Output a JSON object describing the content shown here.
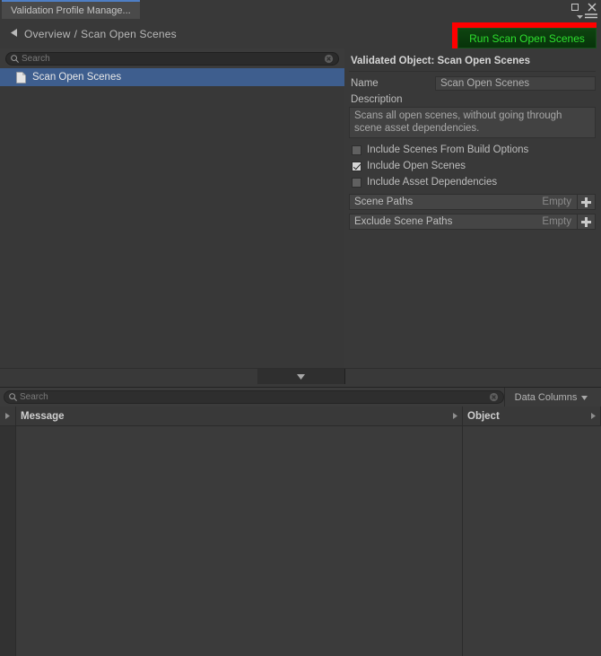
{
  "window": {
    "tab_label": "Validation Profile Manage...",
    "maximize_icon": "maximize-icon",
    "close_icon": "close-icon",
    "menu_icon": "hamburger-menu-icon"
  },
  "breadcrumb": {
    "back_arrow": "◀",
    "root": "Overview",
    "separator": "/",
    "current": "Scan Open Scenes"
  },
  "run_button": {
    "label": "Run Scan Open Scenes",
    "text_color": "#2ee02e",
    "fill_color": "#0b3c0e",
    "highlight_color": "#ff0000"
  },
  "left_panel": {
    "search": {
      "placeholder": "Search",
      "value": "",
      "icon": "search-icon",
      "clear_icon": "clear-icon"
    },
    "tree_items": [
      {
        "label": "Scan Open Scenes",
        "icon": "document-icon",
        "selected": true
      }
    ],
    "selection_color": "#3e5e8e"
  },
  "inspector": {
    "title": "Validated Object: Scan Open Scenes",
    "name_label": "Name",
    "name_value": "Scan Open Scenes",
    "description_label": "Description",
    "description_value": "Scans all open scenes, without going through scene asset dependencies.",
    "checkboxes": [
      {
        "label": "Include Scenes From Build Options",
        "checked": false
      },
      {
        "label": "Include Open Scenes",
        "checked": true
      },
      {
        "label": "Include Asset Dependencies",
        "checked": false
      }
    ],
    "lists": [
      {
        "label": "Scene Paths",
        "state": "Empty",
        "add_icon": "plus-icon"
      },
      {
        "label": "Exclude Scene Paths",
        "state": "Empty",
        "add_icon": "plus-icon"
      }
    ]
  },
  "splitter": {
    "icon": "chevron-down-icon"
  },
  "results": {
    "search": {
      "placeholder": "Search",
      "value": "",
      "icon": "search-icon",
      "clear_icon": "clear-icon"
    },
    "data_columns_label": "Data Columns",
    "data_columns_icon": "chevron-down-icon",
    "columns": [
      {
        "title": "Message",
        "sort_icon": "chevron-right-icon"
      },
      {
        "title": "Object",
        "sort_icon": "chevron-right-icon"
      }
    ],
    "rows": []
  }
}
